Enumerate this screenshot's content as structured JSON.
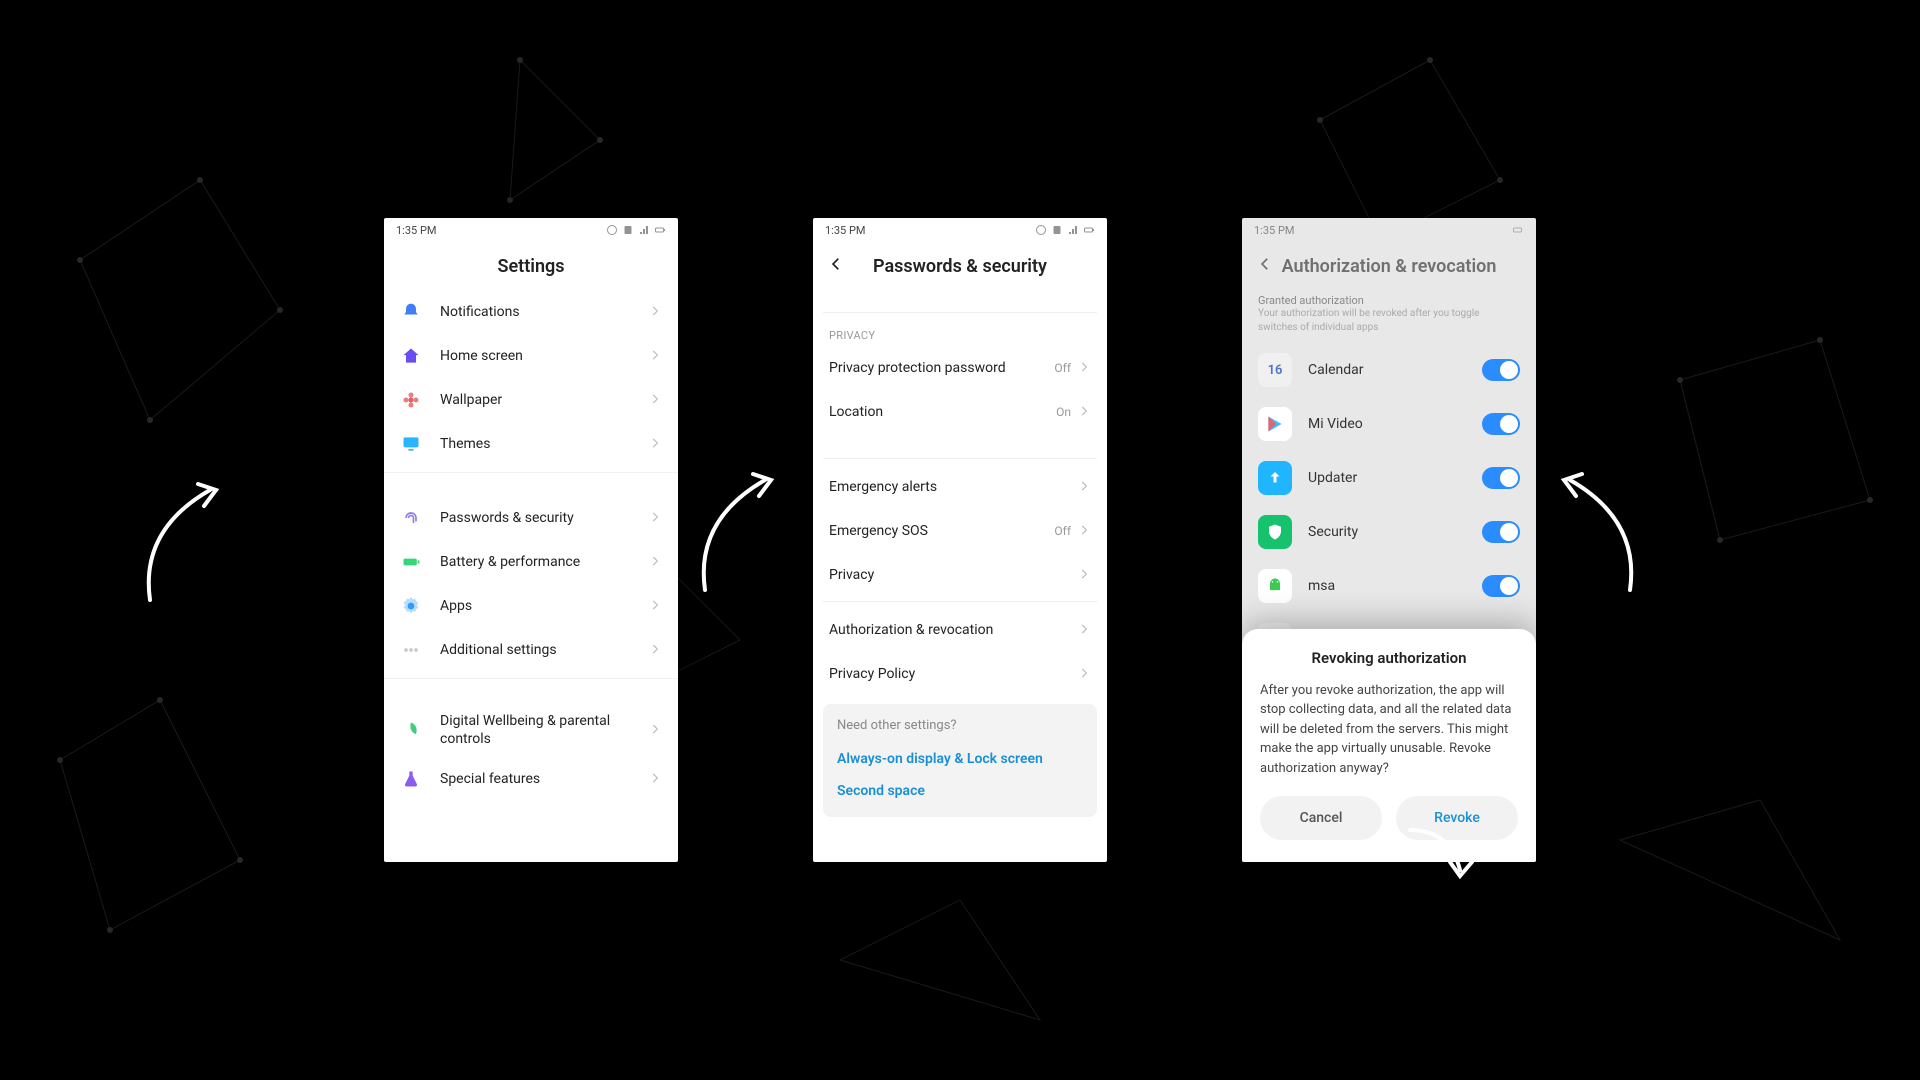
{
  "statusbar": {
    "time": "1:35 PM"
  },
  "screen1": {
    "title": "Settings",
    "group_a": [
      {
        "label": "Notifications",
        "icon": "bell",
        "color": "#3f7ef5"
      },
      {
        "label": "Home screen",
        "icon": "home",
        "color": "#6a4df0"
      },
      {
        "label": "Wallpaper",
        "icon": "flower",
        "color": "#e95d5d"
      },
      {
        "label": "Themes",
        "icon": "monitor",
        "color": "#2bb4ff"
      }
    ],
    "group_b": [
      {
        "label": "Passwords & security",
        "icon": "finger",
        "color": "#8d7cf4"
      },
      {
        "label": "Battery & performance",
        "icon": "battery",
        "color": "#36d678"
      },
      {
        "label": "Apps",
        "icon": "gear",
        "color": "#2e9bff"
      },
      {
        "label": "Additional settings",
        "icon": "dots",
        "color": "#c6c9d6"
      }
    ],
    "group_c": [
      {
        "label": "Digital Wellbeing & parental controls",
        "icon": "leaf",
        "color": "#3fcf7a"
      },
      {
        "label": "Special features",
        "icon": "flask",
        "color": "#8a5df0"
      }
    ]
  },
  "screen2": {
    "title": "Passwords & security",
    "section_label": "PRIVACY",
    "rows_a": [
      {
        "label": "Privacy protection password",
        "value": "Off"
      },
      {
        "label": "Location",
        "value": "On"
      }
    ],
    "rows_b": [
      {
        "label": "Emergency alerts",
        "value": ""
      },
      {
        "label": "Emergency SOS",
        "value": "Off"
      },
      {
        "label": "Privacy",
        "value": ""
      }
    ],
    "rows_c": [
      {
        "label": "Authorization & revocation",
        "value": ""
      },
      {
        "label": "Privacy Policy",
        "value": ""
      }
    ],
    "suggest_q": "Need other settings?",
    "suggest_links": [
      "Always-on display & Lock screen",
      "Second space"
    ]
  },
  "screen3": {
    "title": "Authorization & revocation",
    "hint_title": "Granted authorization",
    "hint_body": "Your authorization will be revoked after you toggle switches of individual apps",
    "apps": [
      {
        "label": "Calendar",
        "bg": "#f0f0f0",
        "text": "16",
        "fg": "#4a75c9"
      },
      {
        "label": "Mi Video",
        "bg": "#ffffff",
        "play": true
      },
      {
        "label": "Updater",
        "bg": "#1fb5ff",
        "up": true
      },
      {
        "label": "Security",
        "bg": "#16c26d",
        "shield": true
      },
      {
        "label": "msa",
        "bg": "#ffffff",
        "droid": true
      }
    ],
    "dialog": {
      "title": "Revoking authorization",
      "body": "After you revoke authorization, the app will stop collecting data, and all the related data will be deleted from the servers. This might make the app virtually unusable. Revoke authorization anyway?",
      "cancel": "Cancel",
      "revoke": "Revoke"
    }
  }
}
